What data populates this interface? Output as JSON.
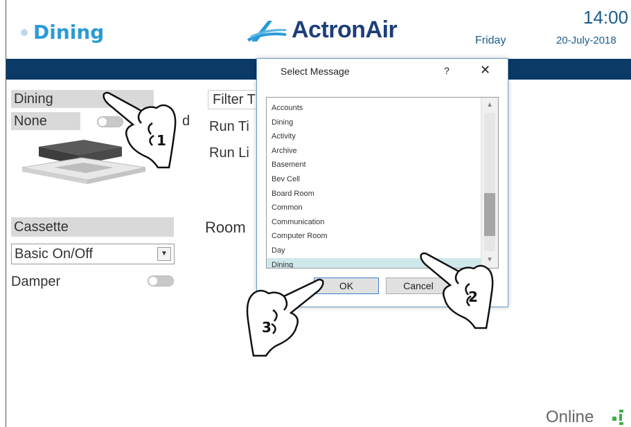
{
  "header": {
    "zone_title": "Dining",
    "brand": "ActronAir",
    "day": "Friday",
    "time": "14:00",
    "date": "20-July-2018"
  },
  "left_panel": {
    "zone_name": "Dining",
    "mode": "None",
    "toggle_label_fragment": "d",
    "unit_type": "Cassette",
    "control_type": "Basic On/Off",
    "damper_label": "Damper"
  },
  "middle_panel": {
    "filter_label": "Filter T",
    "run_time_label": "Run Ti",
    "run_limit_label": "Run Li",
    "room_label": "Room"
  },
  "dialog": {
    "title": "Select Message",
    "help_glyph": "?",
    "close_glyph": "✕",
    "items": [
      "Accounts",
      "Dining",
      "Activity",
      "Archive",
      "Basement",
      "Bev Cell",
      "Board Room",
      "Common",
      "Communication",
      "Computer Room",
      "Day",
      "Dining"
    ],
    "selected_index": 11,
    "ok_label": "OK",
    "cancel_label": "Cancel"
  },
  "callouts": {
    "step1": "1",
    "step2": "2",
    "step3": "3"
  },
  "footer": {
    "status": "Online"
  },
  "colors": {
    "accent": "#2a9bd6",
    "bar": "#0b3a66",
    "brand": "#1c3f7a"
  }
}
